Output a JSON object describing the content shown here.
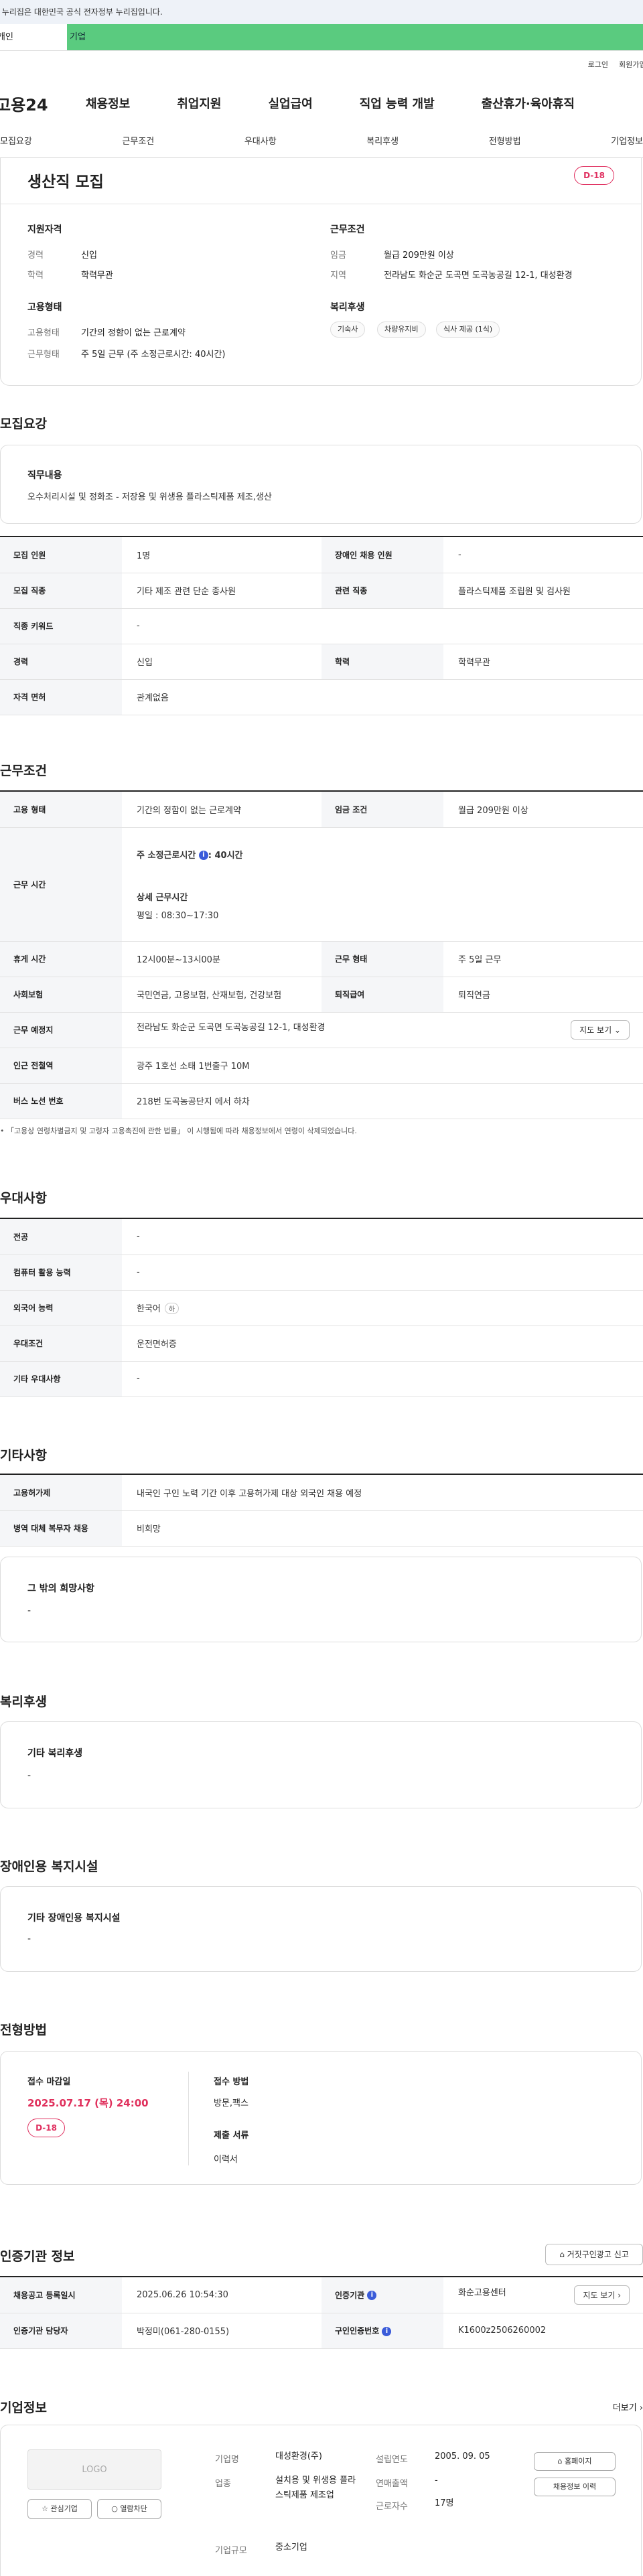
{
  "gov_notice": "이 누리집은 대한민국 공식 전자정부 누리집입니다.",
  "site_tabs": [
    "개인",
    "기업"
  ],
  "util_links": [
    "로그인",
    "회원가입"
  ],
  "logo_text": "고용24",
  "gnb": [
    "채용정보",
    "취업지원",
    "실업급여",
    "직업 능력 개발",
    "출산휴가·육아휴직"
  ],
  "subnav": [
    "모집요강",
    "근무조건",
    "우대사항",
    "복리후생",
    "전형방법",
    "기업정보"
  ],
  "job_title": "생산직 모집",
  "dday": "D-18",
  "summary": {
    "qual_title": "지원자격",
    "qual": [
      {
        "k": "경력",
        "v": "신입"
      },
      {
        "k": "학력",
        "v": "학력무관"
      }
    ],
    "cond_title": "근무조건",
    "cond": [
      {
        "k": "임금",
        "v": "월급 209만원 이상"
      },
      {
        "k": "지역",
        "v": "전라남도 화순군 도곡면 도곡농공길 12-1, 대성환경"
      }
    ],
    "emp_title": "고용형태",
    "emp": [
      {
        "k": "고용형태",
        "v": "기간의 정함이 없는 근로계약"
      },
      {
        "k": "근무형태",
        "v": "주 5일 근무 (주 소정근로시간: 40시간)"
      }
    ],
    "welfare_title": "복리후생",
    "welfare_chips": [
      "기숙사",
      "차량유지비",
      "식사 제공 (1식)"
    ]
  },
  "recruit": {
    "title": "모집요강",
    "duty_title": "직무내용",
    "duty_text": "오수처리시설 및 정화조 - 저장용 및 위생용 플라스틱제품 제조,생산",
    "rows": [
      {
        "k1": "모집 인원",
        "v1": "1명",
        "k2": "장애인 채용 인원",
        "v2": "-"
      },
      {
        "k1": "모집 직종",
        "v1": "기타 제조 관련 단순 종사원",
        "k2": "관련 직종",
        "v2": "플라스틱제품 조립원 및 검사원"
      },
      {
        "k1": "직종 키워드",
        "v1": "-",
        "k2": "",
        "v2": ""
      },
      {
        "k1": "경력",
        "v1": "신입",
        "k2": "학력",
        "v2": "학력무관"
      },
      {
        "k1": "자격 면허",
        "v1": "관계없음",
        "k2": "",
        "v2": ""
      }
    ]
  },
  "work": {
    "title": "근무조건",
    "emp_type_k": "고용 형태",
    "emp_type_v": "기간의 정함이 없는 근로계약",
    "wage_k": "임금 조건",
    "wage_v": "월급 209만원 이상",
    "hours_k": "근무 시간",
    "hours_weekly_label": "주 소정근로시간",
    "hours_weekly_value": ": 40시간",
    "hours_detail_label": "상세 근무시간",
    "hours_detail_value": "평일 : 08:30~17:30",
    "break_k": "휴게 시간",
    "break_v": "12시00분~13시00분",
    "shift_k": "근무 형태",
    "shift_v": "주 5일 근무",
    "insurance_k": "사회보험",
    "insurance_v": "국민연금, 고용보험, 산재보험, 건강보험",
    "severance_k": "퇴직급여",
    "severance_v": "퇴직연금",
    "place_k": "근무 예정지",
    "place_v": "전라남도 화순군 도곡면 도곡농공길 12-1, 대성환경",
    "map_btn": "지도 보기 ⌄",
    "subway_k": "인근 전철역",
    "subway_v": "광주 1호선 소태 1번출구 10M",
    "bus_k": "버스 노선 번호",
    "bus_v": "218번 도곡농공단지 에서 하차",
    "note": "「고용상 연령차별금지 및 고령자 고용촉진에 관한 법률」 이 시행됨에 따라 채용정보에서 연령이 삭제되었습니다."
  },
  "pref": {
    "title": "우대사항",
    "rows": [
      {
        "k": "전공",
        "v": "-"
      },
      {
        "k": "컴퓨터 활용 능력",
        "v": "-"
      },
      {
        "k": "외국어 능력",
        "v": "한국어",
        "badge": "하"
      },
      {
        "k": "우대조건",
        "v": "운전면허증"
      },
      {
        "k": "기타 우대사항",
        "v": "-"
      }
    ]
  },
  "etc": {
    "title": "기타사항",
    "rows": [
      {
        "k": "고용허가제",
        "v": "내국인 구인 노력 기간 이후 고용허가제 대상 외국인 채용 예정"
      },
      {
        "k": "병역 대체 복무자 채용",
        "v": "비희망"
      }
    ],
    "other_title": "그 밖의 희망사항",
    "other_value": "-"
  },
  "benefit": {
    "title": "복리후생",
    "box_title": "기타 복리후생",
    "box_value": "-"
  },
  "disabled": {
    "title": "장애인용 복지시설",
    "box_title": "기타 장애인용 복지시설",
    "box_value": "-"
  },
  "selection": {
    "title": "전형방법",
    "deadline_label": "접수 마감일",
    "deadline_value": "2025.07.17 (목) 24:00",
    "dday": "D-18",
    "method_label": "접수 방법",
    "method_value": "방문,팩스",
    "docs_label": "제출 서류",
    "docs_value": "이력서"
  },
  "cert": {
    "title": "인증기관 정보",
    "report_btn": "거짓구인광고 신고",
    "reg_k": "채용공고 등록일시",
    "reg_v": "2025.06.26 10:54:30",
    "org_k": "인증기관",
    "org_v": "화순고용센터",
    "map_btn": "지도 보기 ›",
    "mgr_k": "인증기관 담당자",
    "mgr_v": "박정미(061-280-0155)",
    "id_k": "구인인증번호",
    "id_v": "K1600z2506260002"
  },
  "company": {
    "title": "기업정보",
    "more": "더보기 ›",
    "logo": "LOGO",
    "fav_btn": "☆ 관심기업",
    "block_btn": "열람차단",
    "name_k": "기업명",
    "name_v": "대성환경(주)",
    "industry_k": "업종",
    "industry_v": "설치용 및 위생용 플라스틱제품 제조업",
    "size_k": "기업규모",
    "size_v": "중소기업",
    "founded_k": "설립연도",
    "founded_v": "2005. 09. 05",
    "sales_k": "연매출액",
    "sales_v": "-",
    "emp_k": "근로자수",
    "emp_v": "17명",
    "home_btn": "홈페이지",
    "history_btn": "채용정보 이력"
  }
}
